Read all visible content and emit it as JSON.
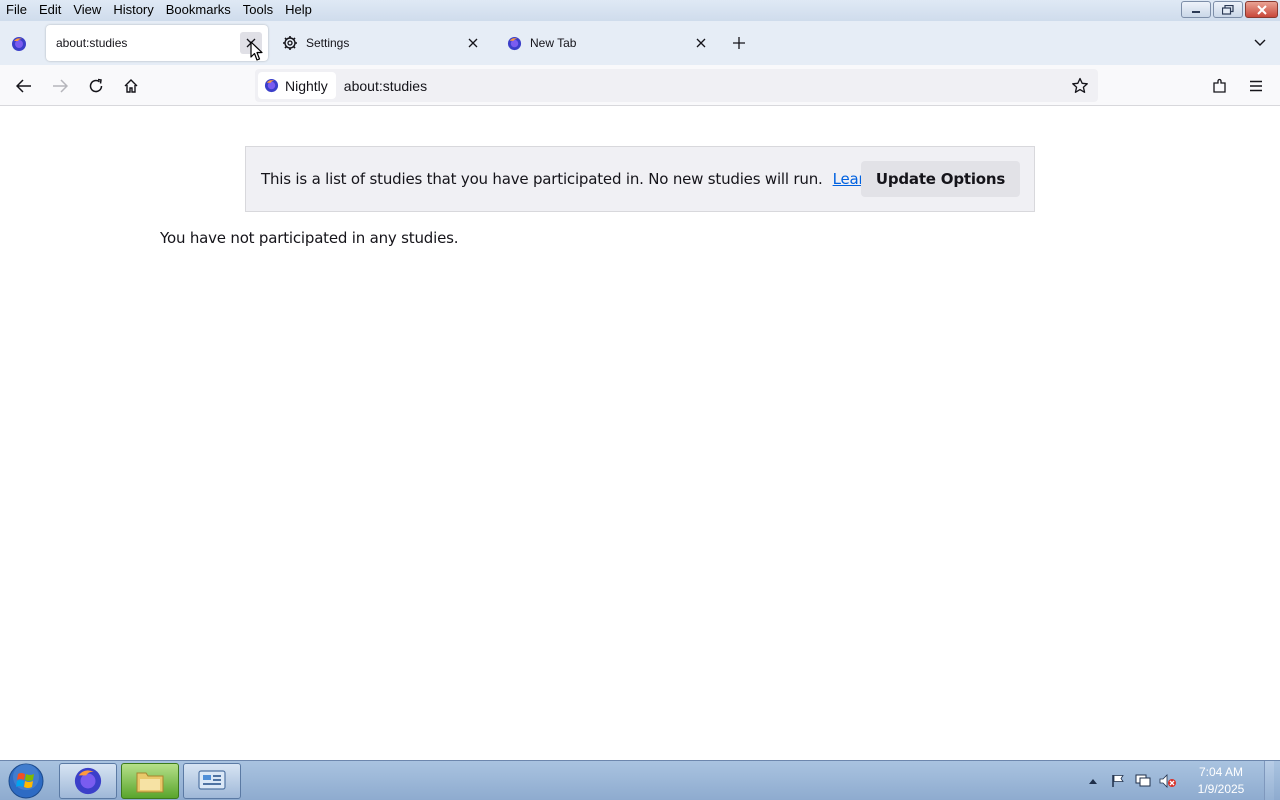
{
  "menubar": {
    "items": [
      "File",
      "Edit",
      "View",
      "History",
      "Bookmarks",
      "Tools",
      "Help"
    ]
  },
  "window_controls": {
    "minimize_icon": "minimize-icon",
    "restore_icon": "restore-icon",
    "close_icon": "close-icon"
  },
  "tabs": [
    {
      "label": "about:studies",
      "active": true,
      "icon": "none"
    },
    {
      "label": "Settings",
      "active": false,
      "icon": "gear-icon"
    },
    {
      "label": "New Tab",
      "active": false,
      "icon": "firefox-icon"
    }
  ],
  "navbar": {
    "identity_label": "Nightly",
    "url": "about:studies"
  },
  "content": {
    "info_text": "This is a list of studies that you have participated in. No new studies will run.",
    "learn_more": "Learn more",
    "update_button": "Update Options",
    "empty_message": "You have not participated in any studies."
  },
  "taskbar": {
    "time": "7:04 AM",
    "date": "1/9/2025"
  },
  "colors": {
    "accent_link": "#0061e0",
    "tabstrip_bg": "#e6edf6",
    "taskbar_bg": "#8eabcf"
  }
}
